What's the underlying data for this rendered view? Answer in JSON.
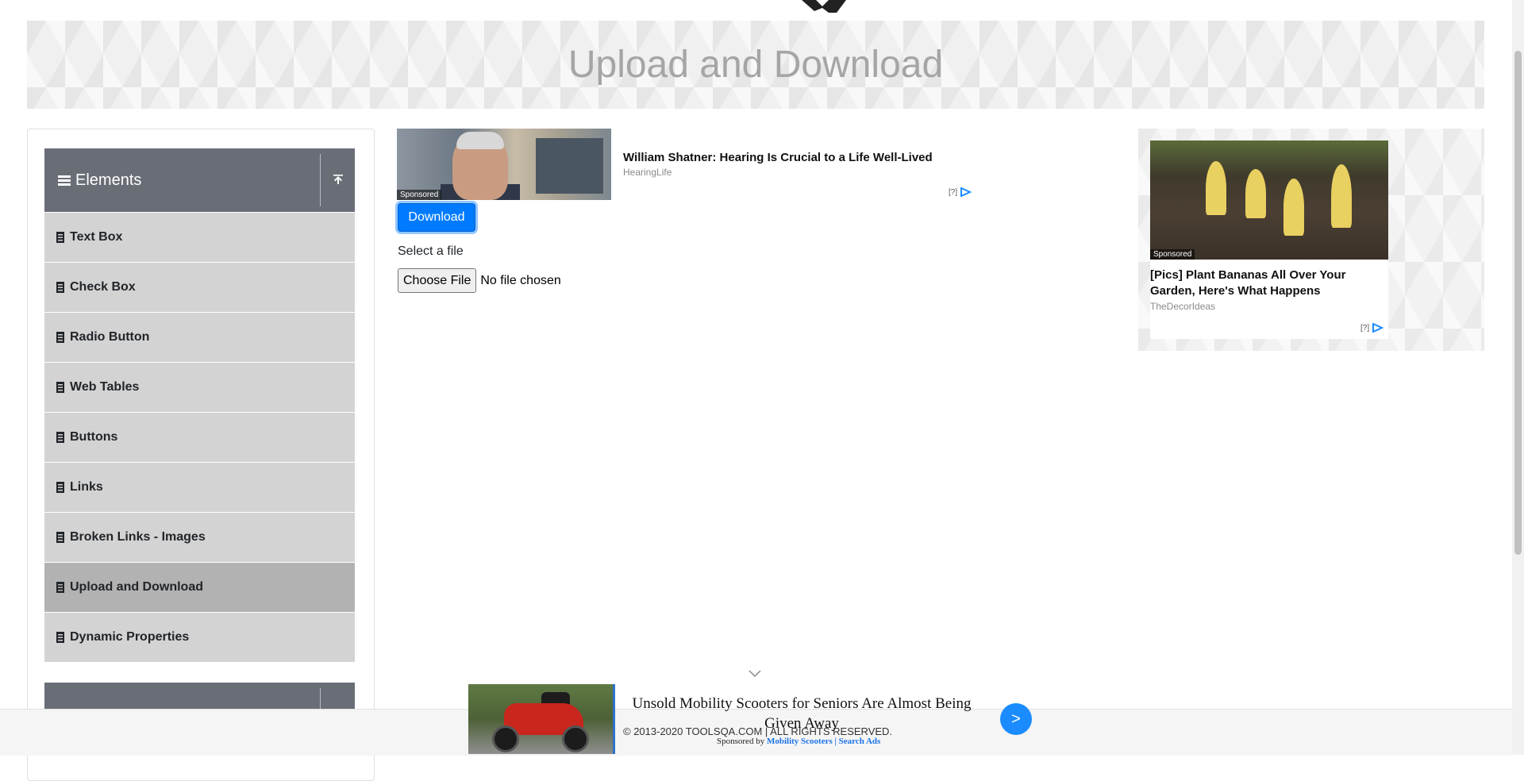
{
  "page": {
    "title": "Upload and Download"
  },
  "sidebar": {
    "group_title": "Elements",
    "items": [
      {
        "label": "Text Box"
      },
      {
        "label": "Check Box"
      },
      {
        "label": "Radio Button"
      },
      {
        "label": "Web Tables"
      },
      {
        "label": "Buttons"
      },
      {
        "label": "Links"
      },
      {
        "label": "Broken Links - Images"
      },
      {
        "label": "Upload and Download",
        "active": true
      },
      {
        "label": "Dynamic Properties"
      }
    ]
  },
  "ad_top": {
    "title": "William Shatner: Hearing Is Crucial to a Life Well-Lived",
    "source": "HearingLife",
    "sponsored": "Sponsored",
    "choices": "[?]"
  },
  "main": {
    "download_label": "Download",
    "select_label": "Select a file",
    "choose_file_label": "Choose File",
    "file_status": "No file chosen"
  },
  "ad_right": {
    "title": "[Pics] Plant Bananas All Over Your Garden, Here's What Happens",
    "source": "TheDecorIdeas",
    "sponsored": "Sponsored",
    "choices": "[?]"
  },
  "bottom_ad": {
    "title": "Unsold Mobility Scooters for Seniors Are Almost Being Given Away",
    "cta": ">",
    "sponsored_by": "Sponsored by",
    "sponsor_links": "Mobility Scooters | Search Ads"
  },
  "footer": {
    "text": "© 2013-2020 TOOLSQA.COM | ALL RIGHTS RESERVED."
  },
  "colors": {
    "accent": "#007bff",
    "sidebar_header": "#696e76",
    "menu_item": "#d3d3d3",
    "menu_active": "#b2b2b2"
  }
}
